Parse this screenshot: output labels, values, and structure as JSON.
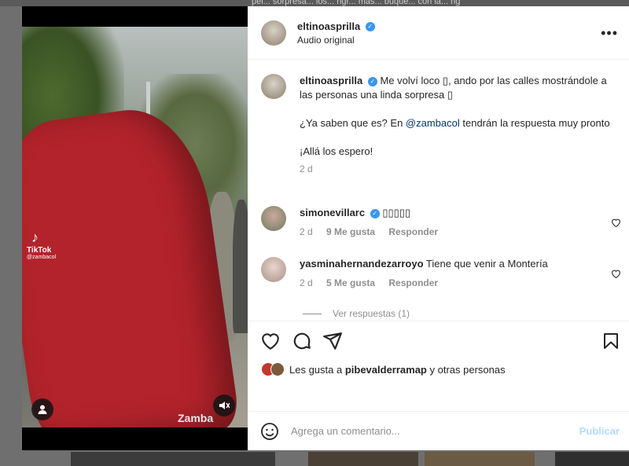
{
  "backdrop": {
    "top_text": "pel... sorpresa... los... ngr... más... buque... con la... ng"
  },
  "media": {
    "watermark_brand": "TikTok",
    "watermark_handle": "@zambacol",
    "video_brand": "Zamba"
  },
  "post": {
    "author": "eltinoasprilla",
    "audio": "Audio original",
    "more_icon": "more-horizontal-icon"
  },
  "caption": {
    "author": "eltinoasprilla",
    "line1": "Me volví loco ▯, ando por las calles mostrándole a las personas una linda sorpresa ▯",
    "line2_pre": "¿Ya saben que es? En ",
    "line2_mention": "@zambacol",
    "line2_post": " tendrán la respuesta muy pronto",
    "line3": "¡Allá los espero!",
    "time": "2 d"
  },
  "comments": [
    {
      "user": "simonevillarc",
      "text": "▯▯▯▯▯",
      "time": "2 d",
      "likes": "9 Me gusta",
      "reply": "Responder"
    },
    {
      "user": "yasminahernandezarroyo",
      "text": "Tiene que venir a Montería",
      "time": "2 d",
      "likes": "5 Me gusta",
      "reply": "Responder"
    }
  ],
  "replies_link": "Ver respuestas (1)",
  "likes": {
    "prefix": "Les gusta a ",
    "user": "pibevalderramap",
    "suffix": " y otras personas"
  },
  "comment_input": {
    "placeholder": "Agrega un comentario...",
    "publish": "Publicar"
  },
  "colors": {
    "verified": "#3897f0",
    "publish_disabled": "#b3dbff",
    "mention": "#00376b"
  }
}
